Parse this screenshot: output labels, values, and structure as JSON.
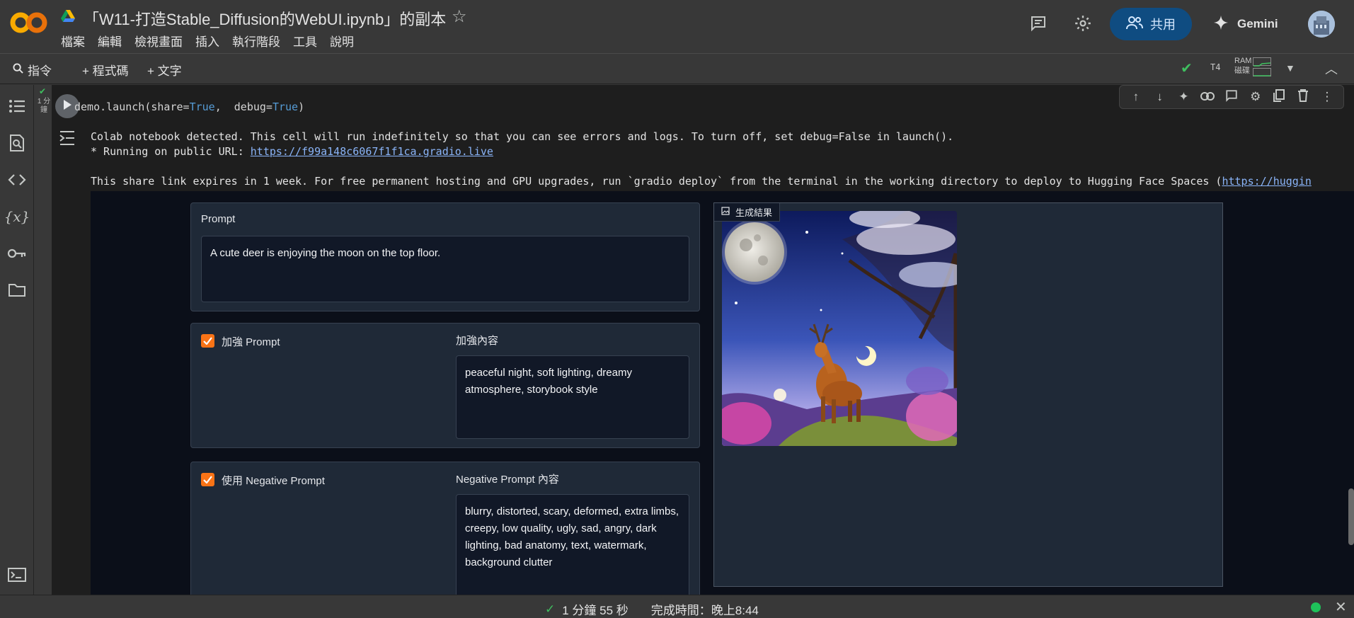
{
  "app": {
    "logo_text": "CO",
    "notebook_title": "「W11-打造Stable_Diffusion的WebUI.ipynb」的副本"
  },
  "menu": [
    "檔案",
    "編輯",
    "檢視畫面",
    "插入",
    "執行階段",
    "工具",
    "說明"
  ],
  "header": {
    "share_label": "共用",
    "gemini_label": "Gemini"
  },
  "toolbar": {
    "command_label": "指令",
    "code_label": "+ 程式碼",
    "text_label": "+ 文字",
    "runtime_type": "T4",
    "ram_label": "RAM",
    "disk_label": "磁碟"
  },
  "cell": {
    "exec_count": "1 分鐘",
    "code_prefix": "demo.launch(share=",
    "code_true1": "True",
    "code_mid": ",  debug=",
    "code_true2": "True",
    "code_suffix": ")"
  },
  "output": {
    "line1": "Colab notebook detected. This cell will run indefinitely so that you can see errors and logs. To turn off, set debug=False in launch().",
    "line2_prefix": "* Running on public URL: ",
    "line2_url": "https://f99a148c6067f1f1ca.gradio.live",
    "line3_prefix": "This share link expires in 1 week. For free permanent hosting and GPU upgrades, run `gradio deploy` from the terminal in the working directory to deploy to Hugging Face Spaces (",
    "line3_url": "https://huggin"
  },
  "gradio": {
    "prompt_label": "Prompt",
    "prompt_value": "A cute deer is enjoying the moon on the top floor.",
    "enhance_checkbox_label": "加強 Prompt",
    "enhance_content_label": "加強內容",
    "enhance_content_value": "peaceful night, soft lighting, dreamy atmosphere, storybook style",
    "negative_checkbox_label": "使用 Negative Prompt",
    "negative_content_label": "Negative Prompt 內容",
    "negative_content_value": "blurry, distorted, scary, deformed, extra limbs, creepy, low quality, ugly, sad, angry, dark lighting, bad anatomy, text, watermark, background clutter",
    "output_label": "生成結果"
  },
  "footer": {
    "elapsed": "1 分鐘 55 秒",
    "completed_label": "完成時間：晚上8:44"
  },
  "colors": {
    "accent_orange": "#f97316",
    "share_blue": "#0f4c81",
    "status_green": "#3fbf5f"
  }
}
